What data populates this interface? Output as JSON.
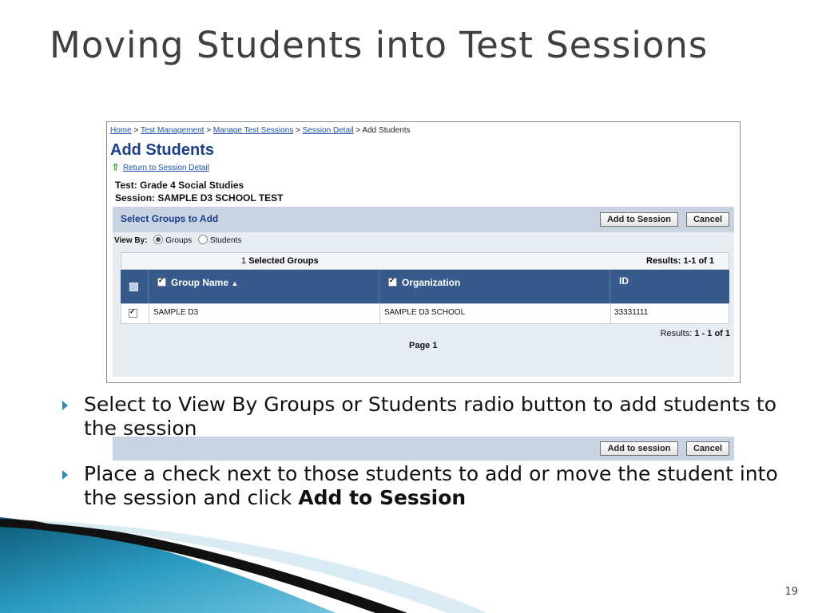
{
  "slide": {
    "title": "Moving Students into Test Sessions",
    "page_number": "19"
  },
  "screenshot": {
    "breadcrumb": {
      "home": "Home",
      "sep": ">",
      "test_management": "Test Management",
      "manage_sessions": "Manage Test Sessions",
      "session_detail": "Session Detail",
      "current": "Add Students"
    },
    "heading": "Add Students",
    "return_link": "Return to Session Detail",
    "test_line": "Test: Grade 4 Social Studies",
    "session_line": "Session: SAMPLE D3 SCHOOL TEST",
    "panel_title": "Select Groups to Add",
    "add_button_top": "Add to Session",
    "cancel_button": "Cancel",
    "view_by_label": "View By:",
    "view_by_options": [
      "Groups",
      "Students"
    ],
    "view_by_selected": "Groups",
    "selected_count": "1",
    "selected_label": "Selected Groups",
    "results_top": "Results: 1-1 of 1",
    "columns": [
      "Group Name",
      "Organization",
      "ID"
    ],
    "rows": [
      {
        "group": "SAMPLE D3",
        "organization": "SAMPLE D3 SCHOOL",
        "id": "33331111",
        "checked": true
      }
    ],
    "results_bottom_label": "Results:",
    "results_bottom_value": "1 - 1 of 1",
    "page_label": "Page 1",
    "add_button_bottom": "Add to session"
  },
  "bullets": [
    {
      "text": "Select to View By Groups or Students radio button to add students to the session",
      "bold": ""
    },
    {
      "text": "Place a check next to those students to add or move the student into the session and click",
      "bold": "Add to Session"
    }
  ],
  "colors": {
    "title": "#404040",
    "header_blue": "#1b3e8c",
    "table_header": "#365a8c",
    "bullet_accent": "#2a8fb4"
  }
}
